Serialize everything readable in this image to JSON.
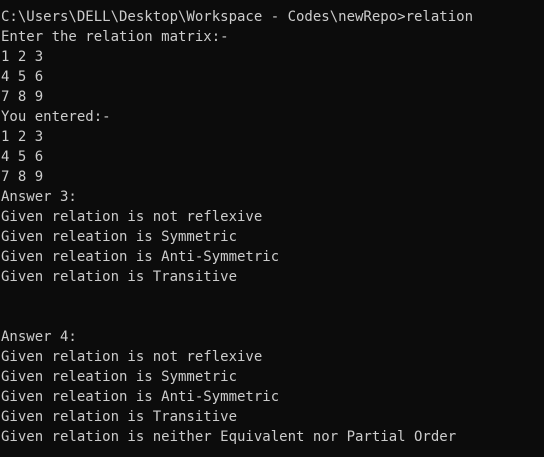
{
  "console": {
    "lines": [
      "C:\\Users\\DELL\\Desktop\\Workspace - Codes\\newRepo>relation",
      "Enter the relation matrix:-",
      "1 2 3",
      "4 5 6",
      "7 8 9",
      "You entered:-",
      "1 2 3",
      "4 5 6",
      "7 8 9",
      "Answer 3:",
      "Given relation is not reflexive",
      "Given releation is Symmetric",
      "Given releation is Anti-Symmetric",
      "Given relation is Transitive",
      "",
      "",
      "Answer 4:",
      "Given relation is not reflexive",
      "Given releation is Symmetric",
      "Given releation is Anti-Symmetric",
      "Given relation is Transitive",
      "Given relation is neither Equivalent nor Partial Order"
    ]
  },
  "colors": {
    "background": "#0c0c0c",
    "text": "#cccccc"
  }
}
